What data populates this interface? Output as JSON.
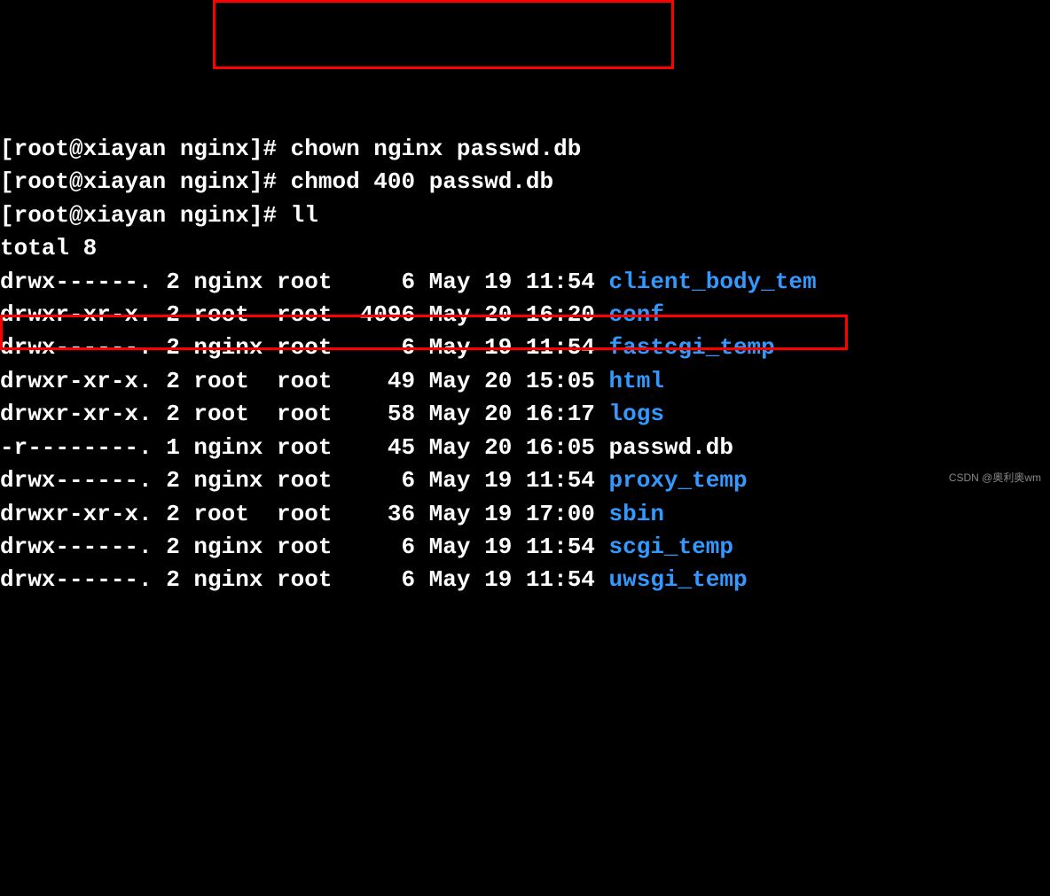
{
  "prompt": "[root@xiayan nginx]#",
  "commands": {
    "cmd1": " chown nginx passwd.db",
    "cmd2": " chmod 400 passwd.db",
    "cmd3": " ll"
  },
  "total": "total 8",
  "rows": [
    {
      "perms": "drwx------. 2 nginx root     6 May 19 11:54 ",
      "name": "client_body_tem",
      "dir": true
    },
    {
      "perms": "drwxr-xr-x. 2 root  root  4096 May 20 16:20 ",
      "name": "conf",
      "dir": true
    },
    {
      "perms": "drwx------. 2 nginx root     6 May 19 11:54 ",
      "name": "fastcgi_temp",
      "dir": true
    },
    {
      "perms": "drwxr-xr-x. 2 root  root    49 May 20 15:05 ",
      "name": "html",
      "dir": true
    },
    {
      "perms": "drwxr-xr-x. 2 root  root    58 May 20 16:17 ",
      "name": "logs",
      "dir": true
    },
    {
      "perms": "-r--------. 1 nginx root    45 May 20 16:05 ",
      "name": "passwd.db",
      "dir": false
    },
    {
      "perms": "drwx------. 2 nginx root     6 May 19 11:54 ",
      "name": "proxy_temp",
      "dir": true
    },
    {
      "perms": "drwxr-xr-x. 2 root  root    36 May 19 17:00 ",
      "name": "sbin",
      "dir": true
    },
    {
      "perms": "drwx------. 2 nginx root     6 May 19 11:54 ",
      "name": "scgi_temp",
      "dir": true
    },
    {
      "perms": "drwx------. 2 nginx root     6 May 19 11:54 ",
      "name": "uwsgi_temp",
      "dir": true
    }
  ],
  "watermark": "CSDN @奥利奥wm"
}
